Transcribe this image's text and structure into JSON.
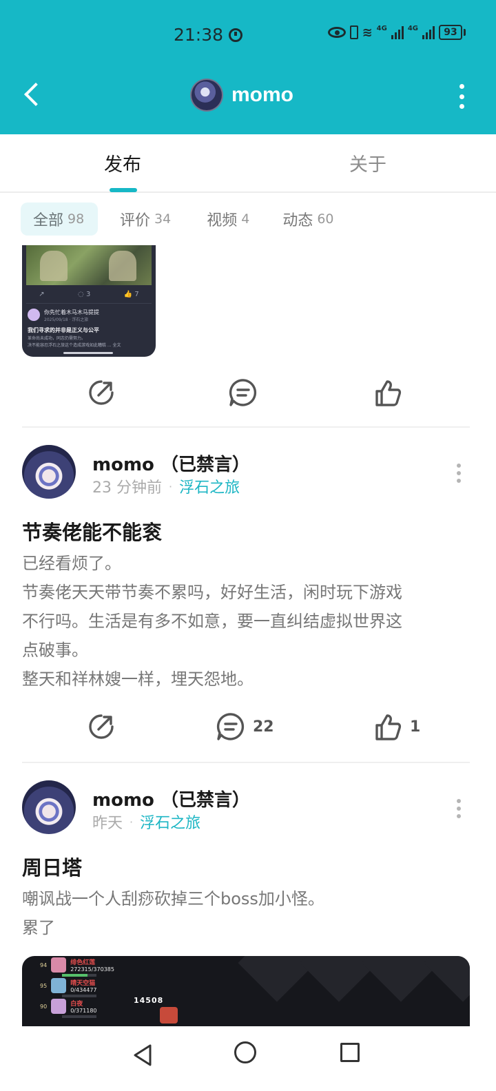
{
  "status_bar": {
    "time": "21:38",
    "network_1": "4G",
    "network_2": "4G",
    "battery": "93"
  },
  "header": {
    "title": "momo",
    "back_icon": "chevron-left-icon",
    "more_icon": "more-vertical-icon"
  },
  "main_tabs": [
    {
      "label": "发布",
      "active": true
    },
    {
      "label": "关于",
      "active": false
    }
  ],
  "filters": [
    {
      "label": "全部",
      "count": "98",
      "active": true
    },
    {
      "label": "评价",
      "count": "34",
      "active": false
    },
    {
      "label": "视频",
      "count": "4",
      "active": false
    },
    {
      "label": "动态",
      "count": "60",
      "active": false
    }
  ],
  "prev_post": {
    "thumbnail": {
      "user_line": "你先忙着木马木马提提",
      "date_line": "2025/09/18 · 浮石之旅",
      "title": "我们寻求的并非是正义与公平",
      "text1": "革命尚未成功，同志仍需努力。",
      "text2": "决不能容忍浮石之旅这个造成游戏如此糟糕 ... 全文",
      "comments": "3",
      "likes": "7"
    },
    "actions": {
      "share": "",
      "comment": "",
      "like": ""
    }
  },
  "posts": [
    {
      "author": "momo （已禁言）",
      "time": "23 分钟前",
      "separator": "·",
      "forum": "浮石之旅",
      "title": "节奏佬能不能衮",
      "body": [
        "已经看烦了。",
        "节奏佬天天带节奏不累吗，好好生活，闲时玩下游戏",
        "不行吗。生活是有多不如意，要一直纠结虚拟世界这",
        "点破事。",
        "整天和祥林嫂一样，埋天怨地。"
      ],
      "comments": "22",
      "likes": "1"
    },
    {
      "author": "momo （已禁言）",
      "time": "昨天",
      "separator": "·",
      "forum": "浮石之旅",
      "title": "周日塔",
      "body": [
        "嘲讽战一个人刮痧砍掉三个boss加小怪。",
        "累了"
      ],
      "game_screen": {
        "rows": [
          {
            "level": "94",
            "name": "绯色红莲",
            "hp": "272315/370385",
            "hp_fraction": 0.74
          },
          {
            "level": "95",
            "name": "晴天空猫",
            "hp": "0/434477",
            "hp_fraction": 0
          },
          {
            "level": "90",
            "name": "白夜",
            "hp": "0/371180",
            "hp_fraction": 0
          }
        ],
        "damage": "14508"
      }
    }
  ],
  "colors": {
    "accent": "#16b8c6",
    "forum_link": "#1db6c4"
  }
}
